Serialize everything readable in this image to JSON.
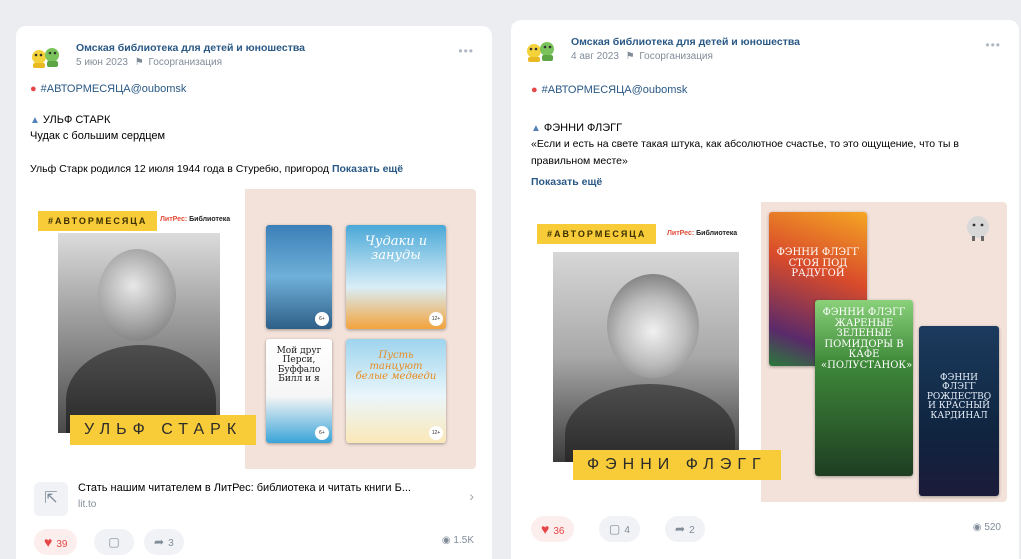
{
  "posts": [
    {
      "group_name": "Омская библиотека для детей и юношества",
      "date": "5 июн 2023",
      "org_type": "Госорганизация",
      "hashtag_line": "#АВТОРМЕСЯЦА@oubomsk",
      "author_heading": "УЛЬФ СТАРК",
      "subtitle": "Чудак с большим сердцем",
      "text": "Ульф Старк родился 12 июля 1944 года в Стуребю, пригород",
      "show_more": "Показать ещё",
      "banner": {
        "hashtag": "#АВТОРМЕСЯЦА",
        "logo_main": "ЛитРес:",
        "logo_sub": "Библиотека",
        "name": "УЛЬФ СТАРК",
        "books": [
          {
            "title": "",
            "age": "6+"
          },
          {
            "title": "Чудаки и зануды",
            "age": "12+"
          },
          {
            "title": "Мой друг Перси, Буффало Билл и я",
            "age": "6+"
          },
          {
            "title": "Пусть танцуют белые медведи",
            "age": "12+"
          }
        ]
      },
      "link": {
        "title": "Стать нашим читателем в ЛитРес: библиотека и читать книги Б...",
        "url": "lit.to"
      },
      "likes": "39",
      "comments": "",
      "shares": "3",
      "views": "1.5K"
    },
    {
      "group_name": "Омская библиотека для детей и юношества",
      "date": "4 авг 2023",
      "org_type": "Госорганизация",
      "hashtag_line": "#АВТОРМЕСЯЦА@oubomsk",
      "author_heading": "ФЭННИ ФЛЭГГ",
      "text": "«Если и есть на свете такая штука, как абсолютное счастье, то это ощущение, что ты в правильном месте»",
      "show_more": "Показать ещё",
      "banner": {
        "hashtag": "#АВТОРМЕСЯЦА",
        "logo_main": "ЛитРес:",
        "logo_sub": "Библиотека",
        "name": "ФЭННИ ФЛЭГГ",
        "books": [
          {
            "title": "ФЭННИ ФЛЭГГ СТОЯ ПОД РАДУГОЙ"
          },
          {
            "title": "ФЭННИ ФЛЭГГ ЖАРЕНЫЕ ЗЕЛЕНЫЕ ПОМИДОРЫ В КАФЕ «ПОЛУСТАНОК»"
          },
          {
            "title": "ФЭННИ ФЛЭГГ РОЖДЕСТВО И КРАСНЫЙ КАРДИНАЛ"
          }
        ]
      },
      "likes": "36",
      "comments": "4",
      "shares": "2",
      "views": "520"
    }
  ],
  "icons": {
    "avatar": "library-mascots-icon",
    "location": "location-pin-icon",
    "person": "person-icon",
    "like": "heart-icon",
    "comment": "comment-icon",
    "share": "share-icon",
    "views": "eye-icon",
    "link": "external-link-icon"
  },
  "colors": {
    "link": "#2a5885",
    "like": "#e64646",
    "banner_yellow": "#f8cc39",
    "banner_bg": "#f3e2da"
  }
}
